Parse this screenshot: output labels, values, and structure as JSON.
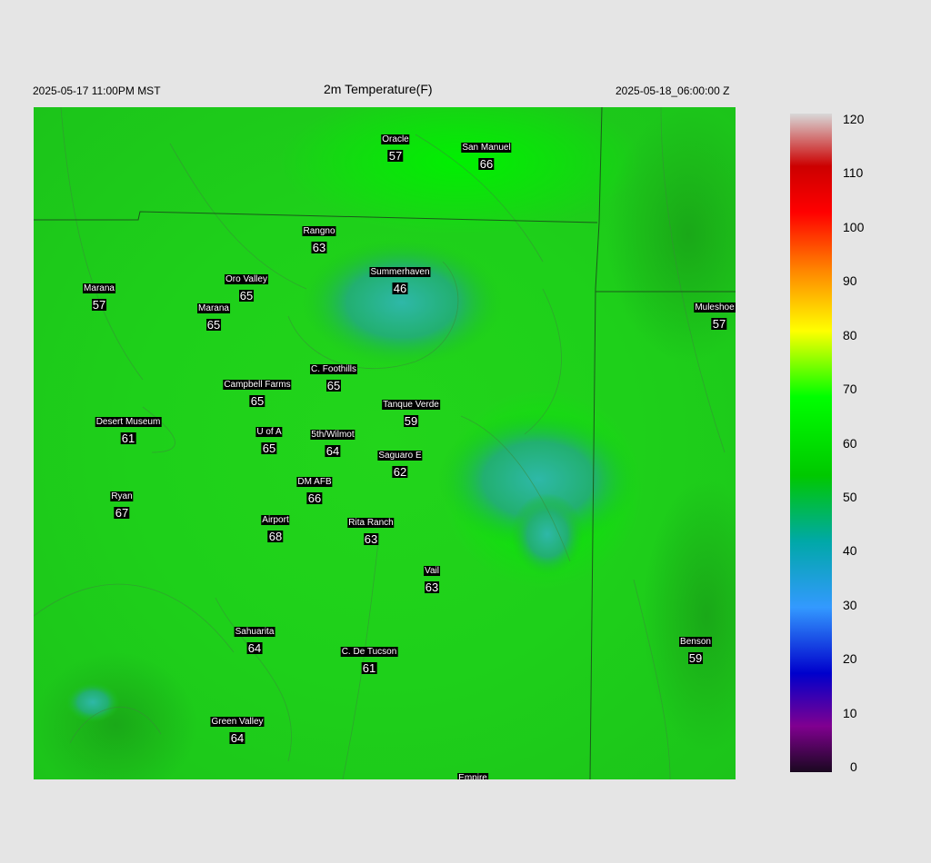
{
  "header": {
    "valid_local": "2025-05-17 11:00PM MST",
    "title": "2m Temperature(F)",
    "valid_utc": "2025-05-18_06:00:00 Z"
  },
  "stations": [
    {
      "name": "Oracle",
      "value": "57"
    },
    {
      "name": "San Manuel",
      "value": "66"
    },
    {
      "name": "Rangno",
      "value": "63"
    },
    {
      "name": "Summerhaven",
      "value": "46"
    },
    {
      "name": "Oro Valley",
      "value": "65"
    },
    {
      "name": "Marana",
      "value": "57"
    },
    {
      "name": "Marana",
      "value": "65"
    },
    {
      "name": "Muleshoe R",
      "value": "57"
    },
    {
      "name": "C. Foothills",
      "value": "65"
    },
    {
      "name": "Campbell Farms",
      "value": "65"
    },
    {
      "name": "Tanque Verde",
      "value": "59"
    },
    {
      "name": "Desert Museum",
      "value": "61"
    },
    {
      "name": "U of A",
      "value": "65"
    },
    {
      "name": "5th/Wilmot",
      "value": "64"
    },
    {
      "name": "Saguaro E",
      "value": "62"
    },
    {
      "name": "DM AFB",
      "value": "66"
    },
    {
      "name": "Ryan",
      "value": "67"
    },
    {
      "name": "Airport",
      "value": "68"
    },
    {
      "name": "Rita Ranch",
      "value": "63"
    },
    {
      "name": "Vail",
      "value": "63"
    },
    {
      "name": "Sahuarita",
      "value": "64"
    },
    {
      "name": "C. De Tucson",
      "value": "61"
    },
    {
      "name": "Benson",
      "value": "59"
    },
    {
      "name": "Green Valley",
      "value": "64"
    },
    {
      "name": "Empire",
      "value": ""
    }
  ],
  "colorbar": {
    "ticks": [
      "0",
      "10",
      "20",
      "30",
      "40",
      "50",
      "60",
      "70",
      "80",
      "90",
      "100",
      "110",
      "120"
    ],
    "stops": [
      "#1a0820",
      "#800090",
      "#0000cc",
      "#3399ff",
      "#00a8a8",
      "#00c800",
      "#00ff00",
      "#ffff00",
      "#ff8800",
      "#ff0000",
      "#d8d8d8"
    ]
  }
}
